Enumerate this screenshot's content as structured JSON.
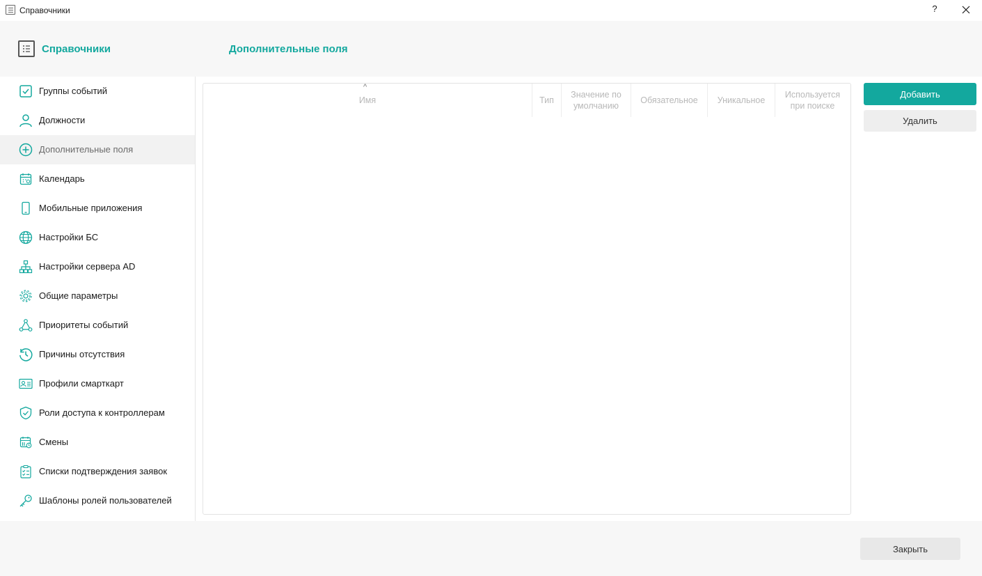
{
  "window": {
    "title": "Справочники",
    "help_label": "?"
  },
  "header": {
    "title": "Справочники",
    "section_title": "Дополнительные поля"
  },
  "sidebar": {
    "items": [
      {
        "label": "Группы событий",
        "icon": "checkbox-icon"
      },
      {
        "label": "Должности",
        "icon": "user-icon"
      },
      {
        "label": "Дополнительные поля",
        "icon": "plus-circle-icon",
        "active": true
      },
      {
        "label": "Календарь",
        "icon": "calendar-icon"
      },
      {
        "label": "Мобильные приложения",
        "icon": "mobile-icon"
      },
      {
        "label": "Настройки БС",
        "icon": "globe-icon"
      },
      {
        "label": "Настройки сервера AD",
        "icon": "network-icon"
      },
      {
        "label": "Общие параметры",
        "icon": "gear-icon"
      },
      {
        "label": "Приоритеты событий",
        "icon": "nodes-icon"
      },
      {
        "label": "Причины отсутствия",
        "icon": "history-clock-icon"
      },
      {
        "label": "Профили смарткарт",
        "icon": "id-card-icon"
      },
      {
        "label": "Роли доступа к контроллерам",
        "icon": "shield-check-icon"
      },
      {
        "label": "Смены",
        "icon": "calendar-clock-icon"
      },
      {
        "label": "Списки подтверждения заявок",
        "icon": "clipboard-check-icon"
      },
      {
        "label": "Шаблоны ролей пользователей",
        "icon": "key-icon"
      }
    ]
  },
  "table": {
    "sort_indicator": "^",
    "columns": [
      {
        "label": "Имя"
      },
      {
        "label": "Тип"
      },
      {
        "label": "Значение по умолчанию"
      },
      {
        "label": "Обязательное"
      },
      {
        "label": "Уникальное"
      },
      {
        "label": "Используется при поиске"
      }
    ],
    "rows": []
  },
  "actions": {
    "add_label": "Добавить",
    "delete_label": "Удалить"
  },
  "footer": {
    "close_label": "Закрыть"
  },
  "colors": {
    "accent": "#13a89e",
    "icon": "#13a89e"
  }
}
